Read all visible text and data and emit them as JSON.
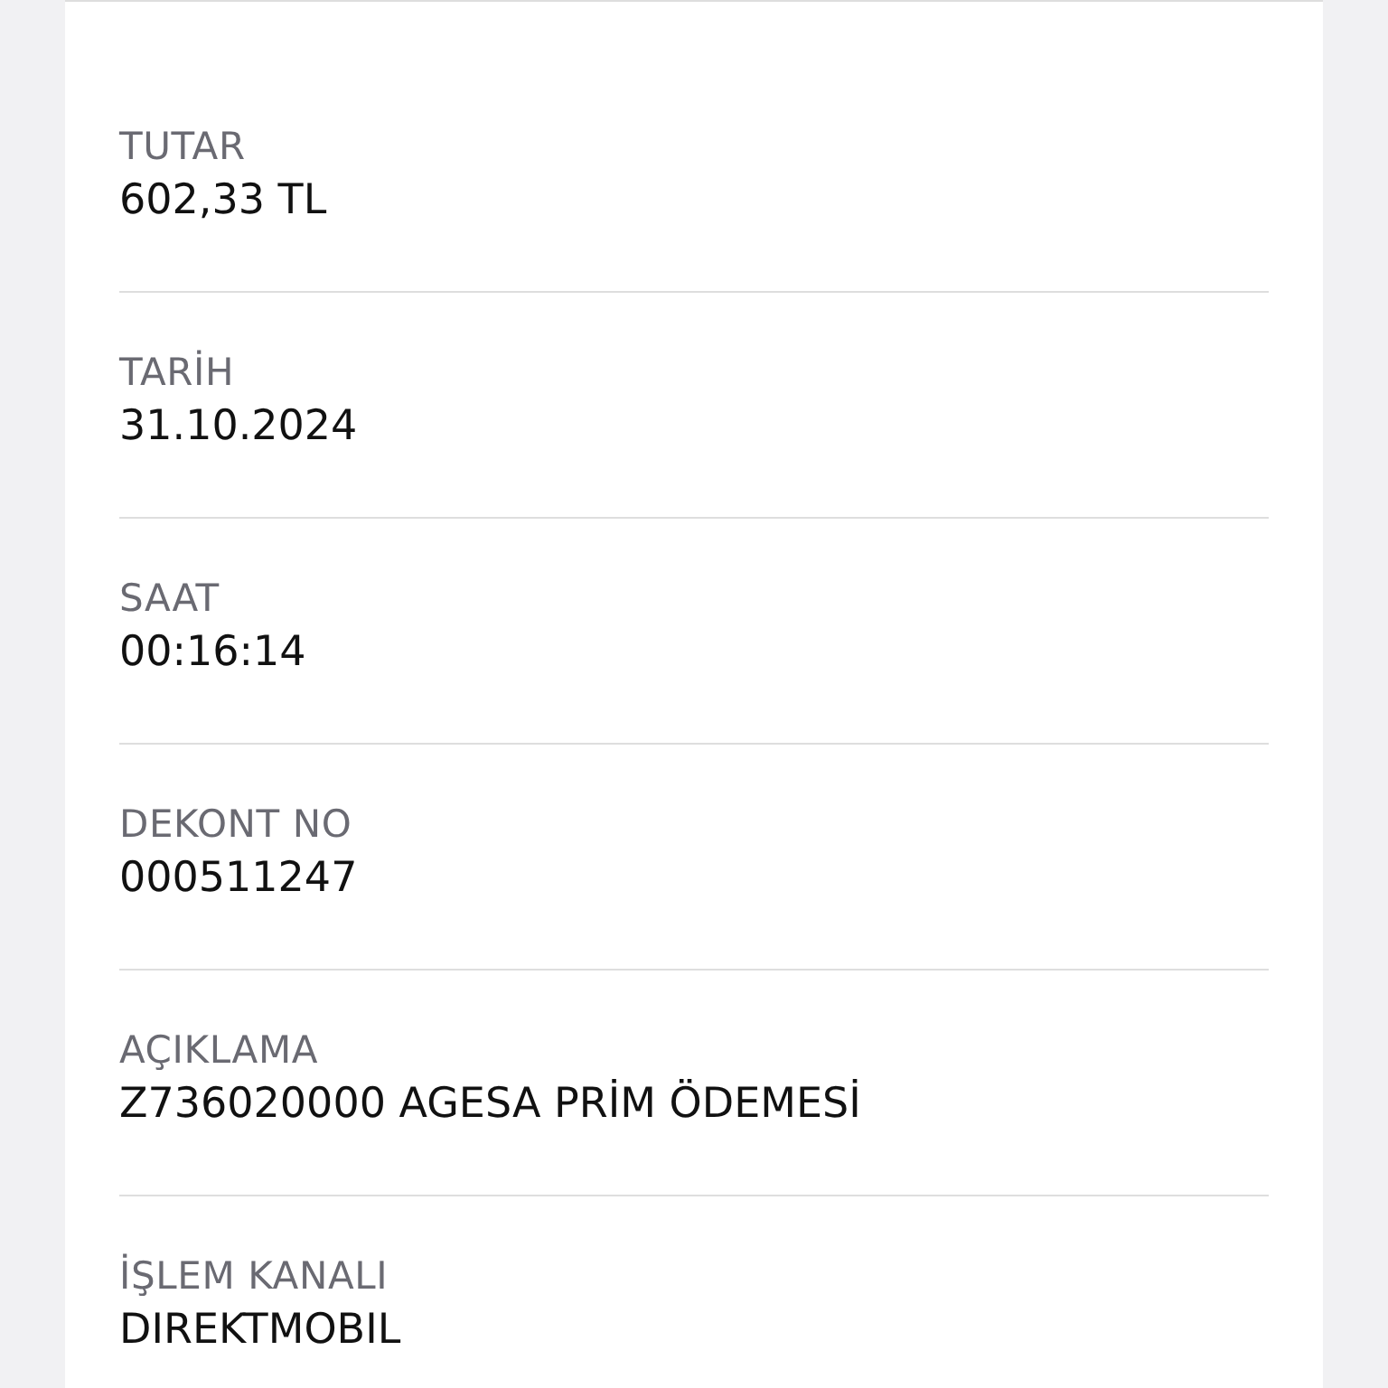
{
  "fields": [
    {
      "label": "TUTAR",
      "value": "602,33 TL"
    },
    {
      "label": "TARİH",
      "value": "31.10.2024"
    },
    {
      "label": "SAAT",
      "value": "00:16:14"
    },
    {
      "label": "DEKONT NO",
      "value": "000511247"
    },
    {
      "label": "AÇIKLAMA",
      "value": "Z736020000 AGESA PRİM ÖDEMESİ"
    },
    {
      "label": "İŞLEM KANALI",
      "value": "DIREKTMOBIL"
    }
  ]
}
